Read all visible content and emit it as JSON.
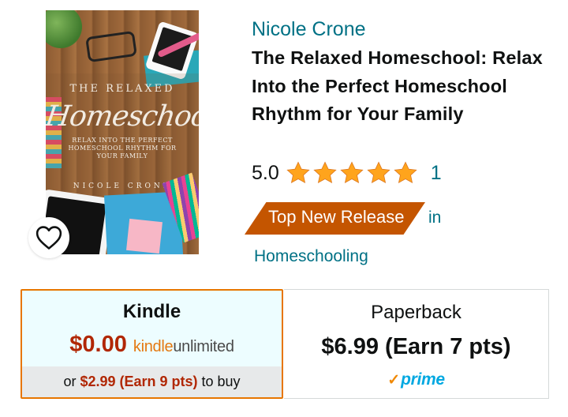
{
  "product": {
    "author": "Nicole Crone",
    "title": "The Relaxed Homeschool: Relax Into the Perfect Homeschool Rhythm for Your Family",
    "rating": "5.0",
    "rating_stars": 5,
    "rating_count": "1",
    "badge": "Top New Release",
    "badge_in": "in",
    "category": "Homeschooling"
  },
  "cover": {
    "title_line1": "THE RELAXED",
    "title_line2": "Homeschool",
    "subtitle": "RELAX INTO THE PERFECT HOMESCHOOL RHYTHM FOR YOUR FAMILY",
    "author": "NICOLE CRONE"
  },
  "formats": {
    "kindle": {
      "label": "Kindle",
      "price": "$0.00",
      "ku_part1": "kindle",
      "ku_part2": "unlimited",
      "buy_prefix": "or",
      "buy_price": "$2.99 (Earn 9 pts)",
      "buy_suffix": "to buy"
    },
    "paperback": {
      "label": "Paperback",
      "price": "$6.99 (Earn 7 pts)",
      "prime_label": "prime"
    }
  },
  "icons": {
    "wishlist": "heart-outline-icon",
    "star": "star-filled-icon",
    "prime_check": "prime-check-icon"
  },
  "colors": {
    "link": "#007185",
    "badge": "#c45500",
    "star": "#ffa41c",
    "price": "#b12704",
    "selected_border": "#e77600",
    "prime_blue": "#00a8e1"
  }
}
